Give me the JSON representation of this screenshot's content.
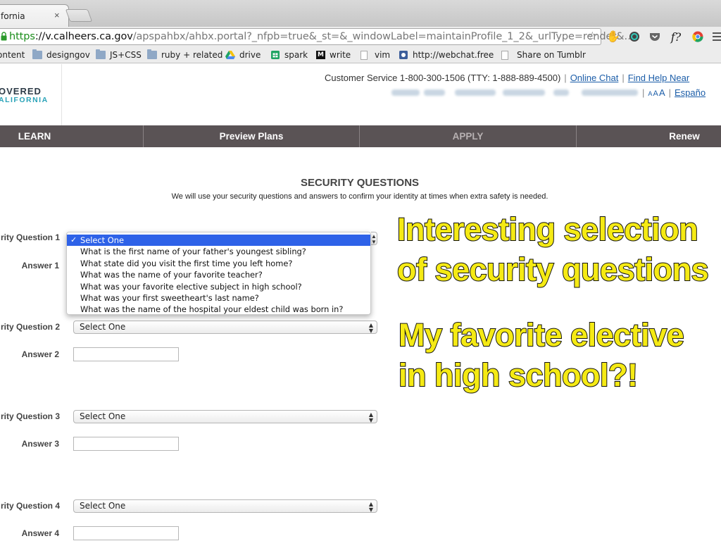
{
  "browser": {
    "tab_title": "fornia",
    "tab_close": "×",
    "url_scheme": "https",
    "url_sep": "://",
    "url_host": "v.calheers.ca.gov",
    "url_path": "/apspahbx/ahbx.portal?_nfpb=true&_st=&_windowLabel=maintainProfile_1_2&_urlType=render&…",
    "star": "☆",
    "extensions": [
      "hand-icon",
      "color-wheel-icon",
      "pocket-icon",
      "font-icon",
      "chrome-icon",
      "menu-icon"
    ],
    "ext_font_label": "f?",
    "bookmarks": [
      {
        "label": "ontent",
        "icon": "folder"
      },
      {
        "label": "designgov",
        "icon": "folder"
      },
      {
        "label": "JS+CSS",
        "icon": "folder"
      },
      {
        "label": "ruby + related",
        "icon": "folder"
      },
      {
        "label": "drive",
        "icon": "drive"
      },
      {
        "label": "spark",
        "icon": "sheet"
      },
      {
        "label": "write",
        "icon": "medium"
      },
      {
        "label": "vim",
        "icon": "page"
      },
      {
        "label": "http://webchat.free",
        "icon": "webchat"
      },
      {
        "label": "Share on Tumblr",
        "icon": "page"
      }
    ]
  },
  "site": {
    "logo_line1": "OVERED",
    "logo_line2": "ALIFORNIA",
    "customer_service": "Customer Service 1-800-300-1506 (TTY: 1-888-889-4500)",
    "online_chat": "Online Chat",
    "find_help": "Find Help Near",
    "text_size": [
      "A",
      "A",
      "A"
    ],
    "espanol": "Españo",
    "nav": [
      "LEARN",
      "Preview Plans",
      "APPLY",
      "Renew"
    ]
  },
  "form": {
    "title": "SECURITY QUESTIONS",
    "subtitle": "We will use your security questions and answers to confirm your identity at times when extra safety is needed.",
    "questions": [
      {
        "label": "rity Question 1",
        "answer_label": "Answer 1",
        "selected": "Select One"
      },
      {
        "label": "rity Question 2",
        "answer_label": "Answer 2",
        "selected": "Select One"
      },
      {
        "label": "rity Question 3",
        "answer_label": "Answer 3",
        "selected": "Select One"
      },
      {
        "label": "rity Question 4",
        "answer_label": "Answer 4",
        "selected": "Select One"
      }
    ],
    "dropdown_options": [
      "Select One",
      "What is the first name of your father's youngest sibling?",
      "What state did you visit the first time you left home?",
      "What was the name of your favorite teacher?",
      "What was your favorite elective subject in high school?",
      "What was your first sweetheart's last name?",
      "What was the name of the hospital your eldest child was born in?"
    ],
    "checkmark": "✓"
  },
  "annotations": {
    "note1_line1": "Interesting selection",
    "note1_line2": "of security questions",
    "note2_line1": "My favorite elective",
    "note2_line2": "in high school?!",
    "text_color": "#f5ea14",
    "stroke_color": "#111111"
  }
}
